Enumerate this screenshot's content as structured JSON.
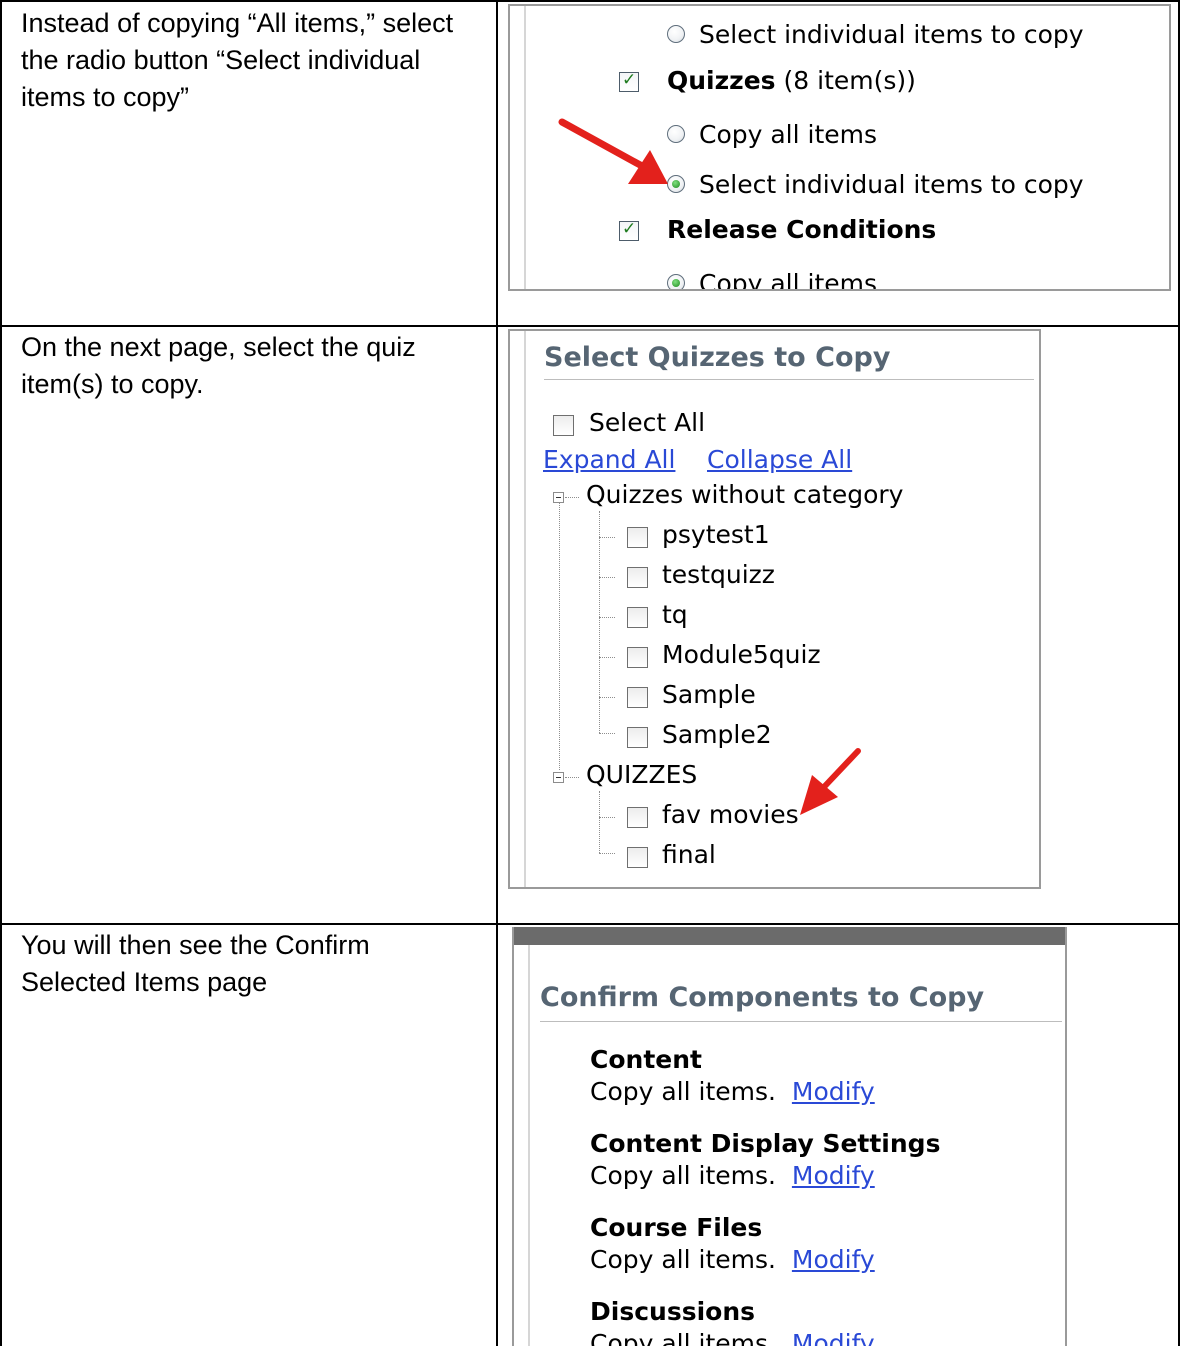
{
  "rows": [
    {
      "instruction": "Instead of copying “All items,” select the radio button “Select individual items to copy”"
    },
    {
      "instruction": "On the next page, select the quiz item(s) to copy."
    },
    {
      "instruction": "You will then see the Confirm Selected Items page"
    }
  ],
  "shot1": {
    "options_top": {
      "select_individual": "Select individual items to copy"
    },
    "quizzes": {
      "label": "Quizzes",
      "count": "(8 item(s))",
      "checked": true
    },
    "quiz_options": {
      "copy_all": "Copy all items",
      "select_individual": "Select individual items to copy",
      "selected": "select_individual"
    },
    "release": {
      "label": "Release Conditions",
      "checked": true
    },
    "release_options": {
      "copy_all": "Copy all items"
    }
  },
  "shot2": {
    "title": "Select Quizzes to Copy",
    "select_all": "Select All",
    "expand_all": "Expand All",
    "collapse_all": "Collapse All",
    "groups": [
      {
        "name": "Quizzes without category",
        "items": [
          "psytest1",
          "testquizz",
          "tq",
          "Module5quiz",
          "Sample",
          "Sample2"
        ]
      },
      {
        "name": "QUIZZES",
        "items": [
          "fav movies",
          "final"
        ]
      }
    ]
  },
  "shot3": {
    "title": "Confirm Components to Copy",
    "components": [
      {
        "name": "Content",
        "status": "Copy all items.",
        "action": "Modify"
      },
      {
        "name": "Content Display Settings",
        "status": "Copy all items.",
        "action": "Modify"
      },
      {
        "name": "Course Files",
        "status": "Copy all items.",
        "action": "Modify"
      },
      {
        "name": "Discussions",
        "status": "Copy all items.",
        "action": "Modify"
      }
    ]
  },
  "colors": {
    "arrow": "#e3211c",
    "link": "#2a49d6",
    "heading": "#566573",
    "checkmark": "#1e7a1e"
  }
}
